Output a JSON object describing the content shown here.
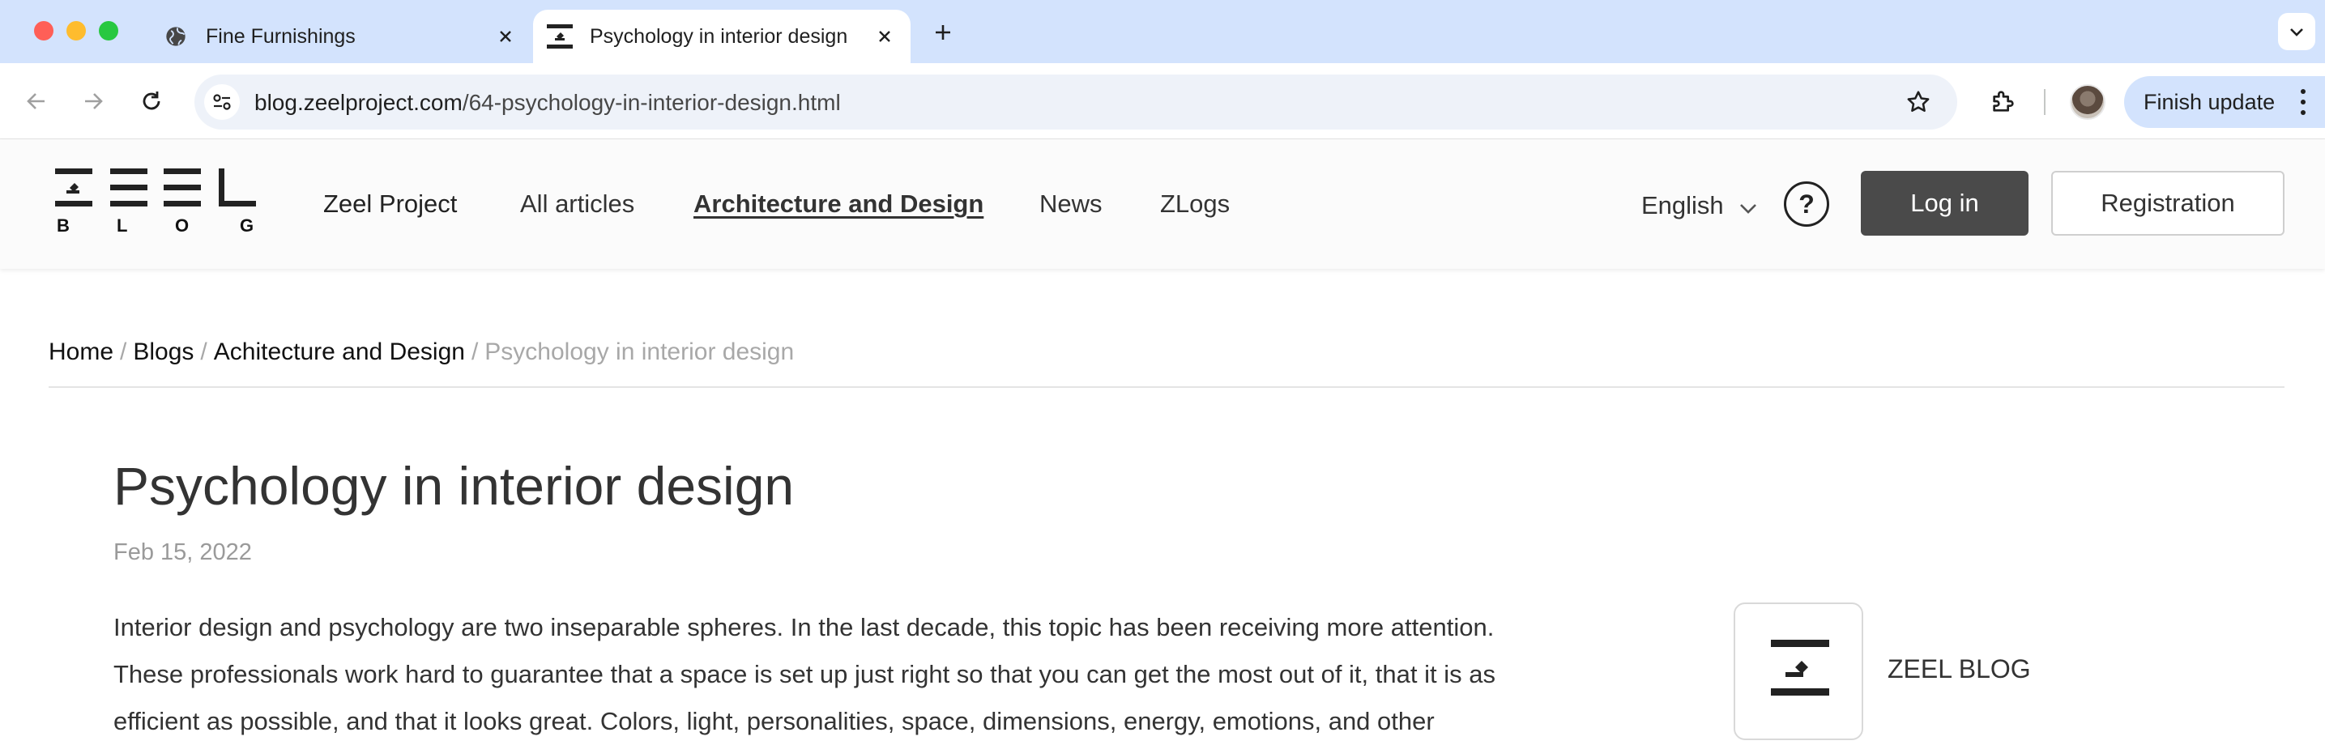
{
  "browser": {
    "tabs": [
      {
        "title": "Fine Furnishings",
        "favicon": "globe-icon",
        "active": false
      },
      {
        "title": "Psychology in interior design",
        "favicon": "zeel-favicon-icon",
        "active": true
      }
    ],
    "url_host": "blog.zeelproject.com",
    "url_path": "/64-psychology-in-interior-design.html",
    "finish_update_label": "Finish update"
  },
  "site": {
    "logo_letters": [
      "B",
      "L",
      "O",
      "G"
    ],
    "nav": [
      {
        "label": "Zeel Project"
      },
      {
        "label": "All articles"
      },
      {
        "label": "Architecture and Design",
        "active": true
      },
      {
        "label": "News"
      },
      {
        "label": "ZLogs"
      }
    ],
    "language": "English",
    "help_symbol": "?",
    "login_label": "Log in",
    "register_label": "Registration"
  },
  "breadcrumb": {
    "items": [
      "Home",
      "Blogs",
      "Achitecture and Design"
    ],
    "separator": "/",
    "current": "Psychology in interior design"
  },
  "article": {
    "title": "Psychology in interior design",
    "date": "Feb 15, 2022",
    "body_lines": [
      "Interior design and psychology are two inseparable spheres. In the last decade, this topic has been receiving more attention.",
      "These professionals work hard to guarantee that a space is set up just right so that you can get the most out of it, that it is as",
      "efficient as possible, and that it looks great. Colors, light, personalities, space, dimensions, energy, emotions, and other"
    ]
  },
  "author": {
    "name": "ZEEL BLOG"
  },
  "colors": {
    "tabbar_bg": "#d3e3fd",
    "login_bg": "#4a4a4a",
    "traffic_red": "#ff5f57",
    "traffic_yellow": "#febc2e",
    "traffic_green": "#28c840"
  }
}
